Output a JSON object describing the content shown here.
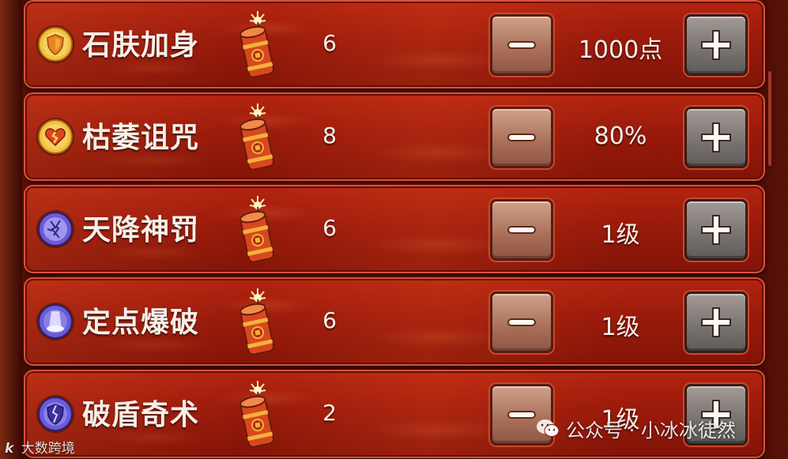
{
  "skills": [
    {
      "name": "石肤加身",
      "count": "6",
      "value": "1000点",
      "icon": "shield-icon",
      "icon_color": "#f2b93b"
    },
    {
      "name": "枯萎诅咒",
      "count": "8",
      "value": "80%",
      "icon": "broken-heart-icon",
      "icon_color": "#f2b93b"
    },
    {
      "name": "天降神罚",
      "count": "6",
      "value": "1级",
      "icon": "lightning-orb-icon",
      "icon_color": "#6b5bd6"
    },
    {
      "name": "定点爆破",
      "count": "6",
      "value": "1级",
      "icon": "beam-strike-icon",
      "icon_color": "#6b5bd6"
    },
    {
      "name": "破盾奇术",
      "count": "2",
      "value": "1级",
      "icon": "broken-shield-icon",
      "icon_color": "#6b5bd6"
    }
  ],
  "item_icon": "firecracker-icon",
  "buttons": {
    "decrease": "minus-icon",
    "increase": "plus-icon"
  },
  "watermark_left": {
    "logo": "k",
    "text": "大数跨境"
  },
  "watermark_right": {
    "text": "公众号 · 小冰冰徒然"
  }
}
